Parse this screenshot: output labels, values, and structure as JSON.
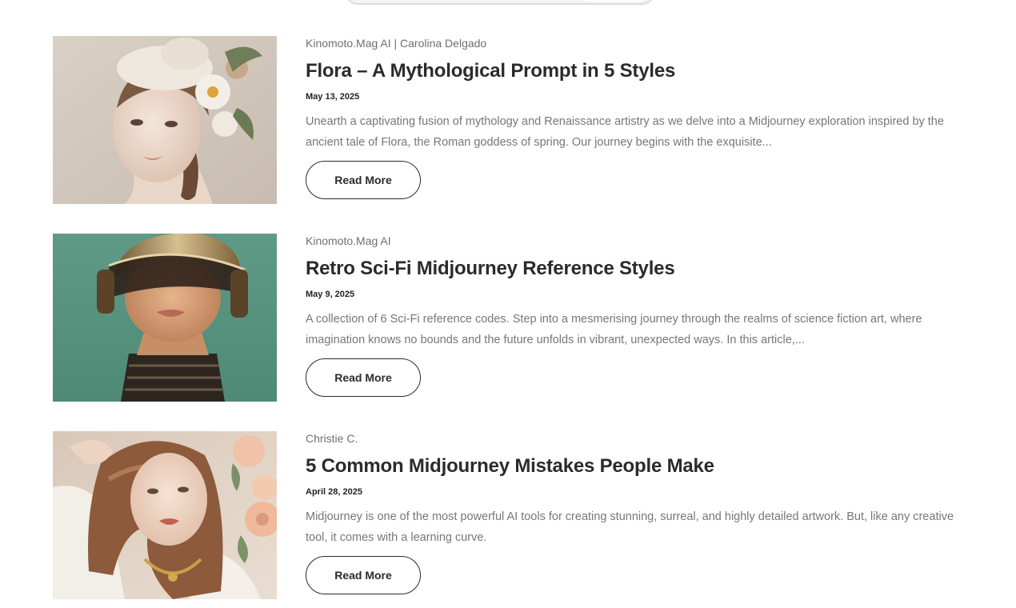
{
  "articles": [
    {
      "author": "Kinomoto.Mag AI | Carolina Delgado",
      "title": "Flora – A Mythological Prompt in 5 Styles",
      "date": "May 13, 2025",
      "excerpt": "Unearth a captivating fusion of mythology and Renaissance artistry as we delve into a Midjourney exploration inspired by the ancient tale of Flora, the Roman goddess of spring. Our journey begins with the exquisite...",
      "button": "Read More",
      "image": "flora-portrait-image"
    },
    {
      "author": "Kinomoto.Mag AI",
      "title": "Retro Sci-Fi Midjourney Reference Styles",
      "date": "May 9, 2025",
      "excerpt": "A collection of 6 Sci-Fi reference codes. Step into a mesmerising journey through the realms of science fiction art, where imagination knows no bounds and the future unfolds in vibrant, unexpected ways. In this article,...",
      "button": "Read More",
      "image": "retro-scifi-helmet-image"
    },
    {
      "author": "Christie C.",
      "title": "5 Common Midjourney Mistakes People Make",
      "date": "April 28, 2025",
      "excerpt": "Midjourney is one of the most powerful AI tools for creating stunning, surreal, and highly detailed artwork. But, like any creative tool, it comes with a learning curve.",
      "button": "Read More",
      "image": "woman-with-roses-image"
    }
  ]
}
